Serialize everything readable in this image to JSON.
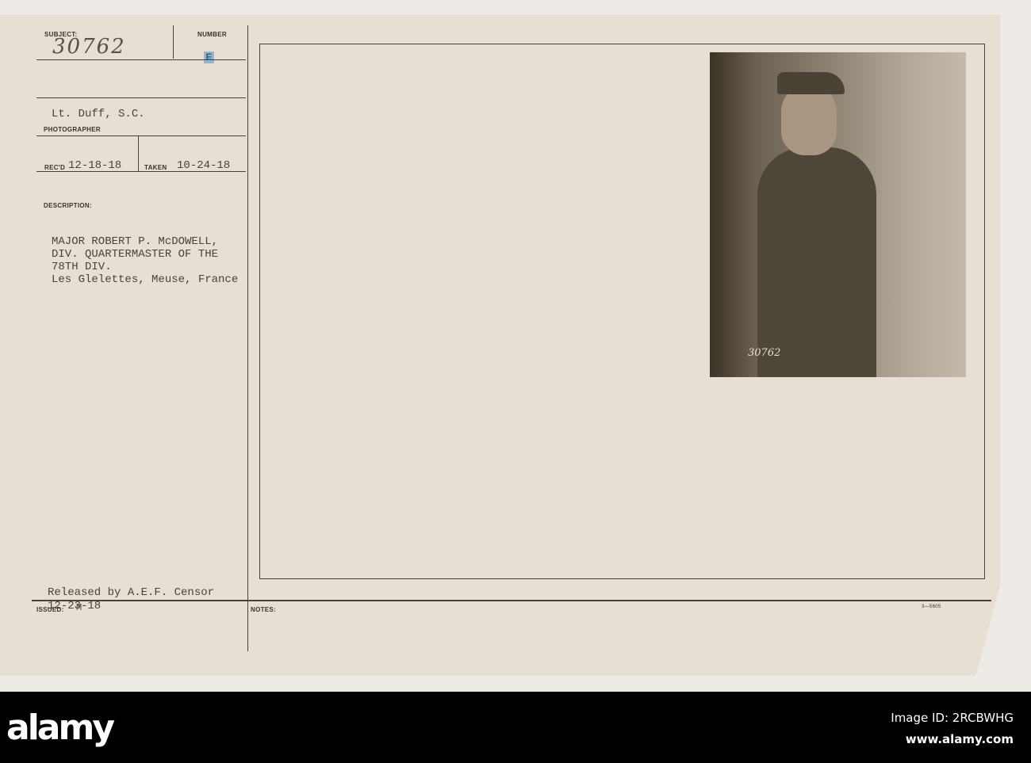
{
  "card": {
    "subject_label": "SUBJECT:",
    "subject_value": "30762",
    "number_label": "NUMBER",
    "number_stamp": "E",
    "photographer_value": "Lt. Duff, S.C.",
    "photographer_label": "PHOTOGRAPHER",
    "recd_label": "REC'D",
    "recd_value": "12-18-18",
    "taken_label": "TAKEN",
    "taken_value": "10-24-18",
    "description_label": "DESCRIPTION:",
    "description_lines": [
      "MAJOR ROBERT P. McDOWELL,",
      "DIV. QUARTERMASTER OF THE",
      "78TH DIV.",
      "Les Glelettes, Meuse, France"
    ],
    "released_lines": [
      "Released by A.E.F. Censor",
      "12-23-18"
    ],
    "issued_label": "ISSUED:",
    "issued_value": "M",
    "notes_label": "NOTES:",
    "form_code": "3—5605",
    "photo_number": "30762"
  },
  "footer": {
    "logo": "alamy",
    "image_id": "Image ID: 2RCBWHG",
    "url": "www.alamy.com"
  }
}
